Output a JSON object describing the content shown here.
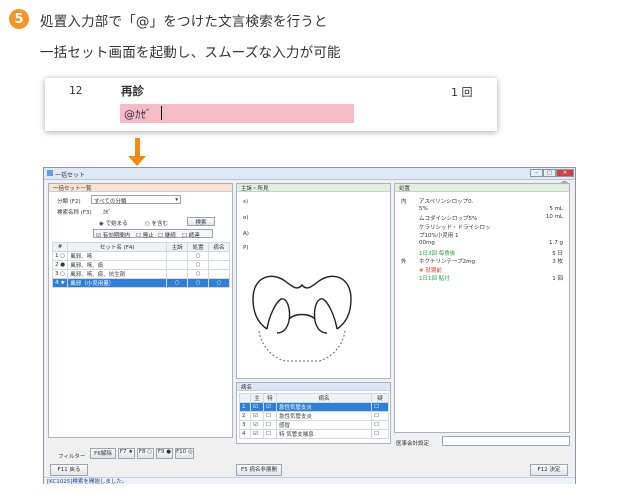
{
  "intro": {
    "step": "5",
    "line1": "処置入力部で「@」をつけた文言検索を行うと",
    "line2": "一括セット画面を起動し、スムーズな入力が可能"
  },
  "input_card": {
    "row_number": "12",
    "row_type": "再診",
    "row_count": "1 回",
    "input_value": "@ｶｾﾞ"
  },
  "window": {
    "title": "一括セット",
    "left_panel": {
      "header": "一括セット一覧",
      "category_label": "分類 (F2)",
      "category_value": "すべての分類",
      "search_label": "検索名称 (F3)",
      "search_value": "ｶｾﾞ",
      "radio_starts": "で始まる",
      "radio_contains": "を含む",
      "search_button": "検索",
      "checks": [
        "有効期間内",
        "廃止",
        "継続",
        "師連"
      ],
      "columns": [
        "#",
        "セット名 (F4)",
        "主訴",
        "処置",
        "病名"
      ],
      "rows": [
        {
          "n": "1",
          "mark": "○",
          "name": "風邪、咳",
          "c1": "",
          "c2": "○",
          "c3": ""
        },
        {
          "n": "2",
          "mark": "●",
          "name": "風邪、咳、痰",
          "c1": "",
          "c2": "○",
          "c3": ""
        },
        {
          "n": "3",
          "mark": "○",
          "name": "風邪、咳、痰、抗生剤",
          "c1": "",
          "c2": "○",
          "c3": ""
        },
        {
          "n": "4",
          "mark": "★",
          "name": "風邪（小児用量）",
          "c1": "○",
          "c2": "○",
          "c3": "○"
        }
      ],
      "filter_label": "フィルター",
      "filter_buttons": [
        "F6解除",
        "F7 ★",
        "F8 ○",
        "F9 ●",
        "F10 ◎"
      ]
    },
    "soap_panel": {
      "header": "主訴・所見",
      "labels": [
        "s)",
        "o)",
        "A)",
        "P)"
      ]
    },
    "disease_panel": {
      "header": "病名",
      "columns": [
        "主",
        "特",
        "病名",
        "疑"
      ],
      "rows": [
        {
          "n": "1",
          "name": "急性気管支炎",
          "sel": true
        },
        {
          "n": "2",
          "name": "急性気管支炎",
          "sel": false
        },
        {
          "n": "3",
          "name": "感冒",
          "sel": false
        },
        {
          "n": "4",
          "name": "気管支喘息",
          "toku": "特",
          "sel": false
        }
      ]
    },
    "order_panel": {
      "header": "処置",
      "lines": [
        {
          "tag": "内",
          "text": "アスペリンシロップ0.",
          "qty": "",
          "cls": ""
        },
        {
          "tag": "",
          "text": "5%",
          "qty": "5 mL",
          "cls": ""
        },
        {
          "tag": "",
          "text": "ムコダインシロップ5%",
          "qty": "10 mL",
          "cls": ""
        },
        {
          "tag": "",
          "text": "ケラリシッド・ドライシロッ",
          "qty": "",
          "cls": ""
        },
        {
          "tag": "",
          "text": "プ10%小児用 1",
          "qty": "",
          "cls": ""
        },
        {
          "tag": "",
          "text": "00mg",
          "qty": "1.7 g",
          "cls": ""
        },
        {
          "tag": "",
          "text": "1日3回 毎食後",
          "qty": "5 日",
          "cls": "green"
        },
        {
          "tag": "外",
          "text": "ホクナリンテープ2mg",
          "qty": "3 枚",
          "cls": ""
        },
        {
          "tag": "",
          "text": "# 就寝前",
          "qty": "",
          "cls": "red"
        },
        {
          "tag": "",
          "text": "1日1回 貼付",
          "qty": "1 回",
          "cls": "green"
        }
      ],
      "medical_label": "医事会計設定"
    },
    "bottom": {
      "back_button": "F11 戻る",
      "collapse_button": "F5 病名非展開",
      "ok_button": "F12 決定",
      "status": "[KC1025]検索を開始しました。"
    }
  }
}
